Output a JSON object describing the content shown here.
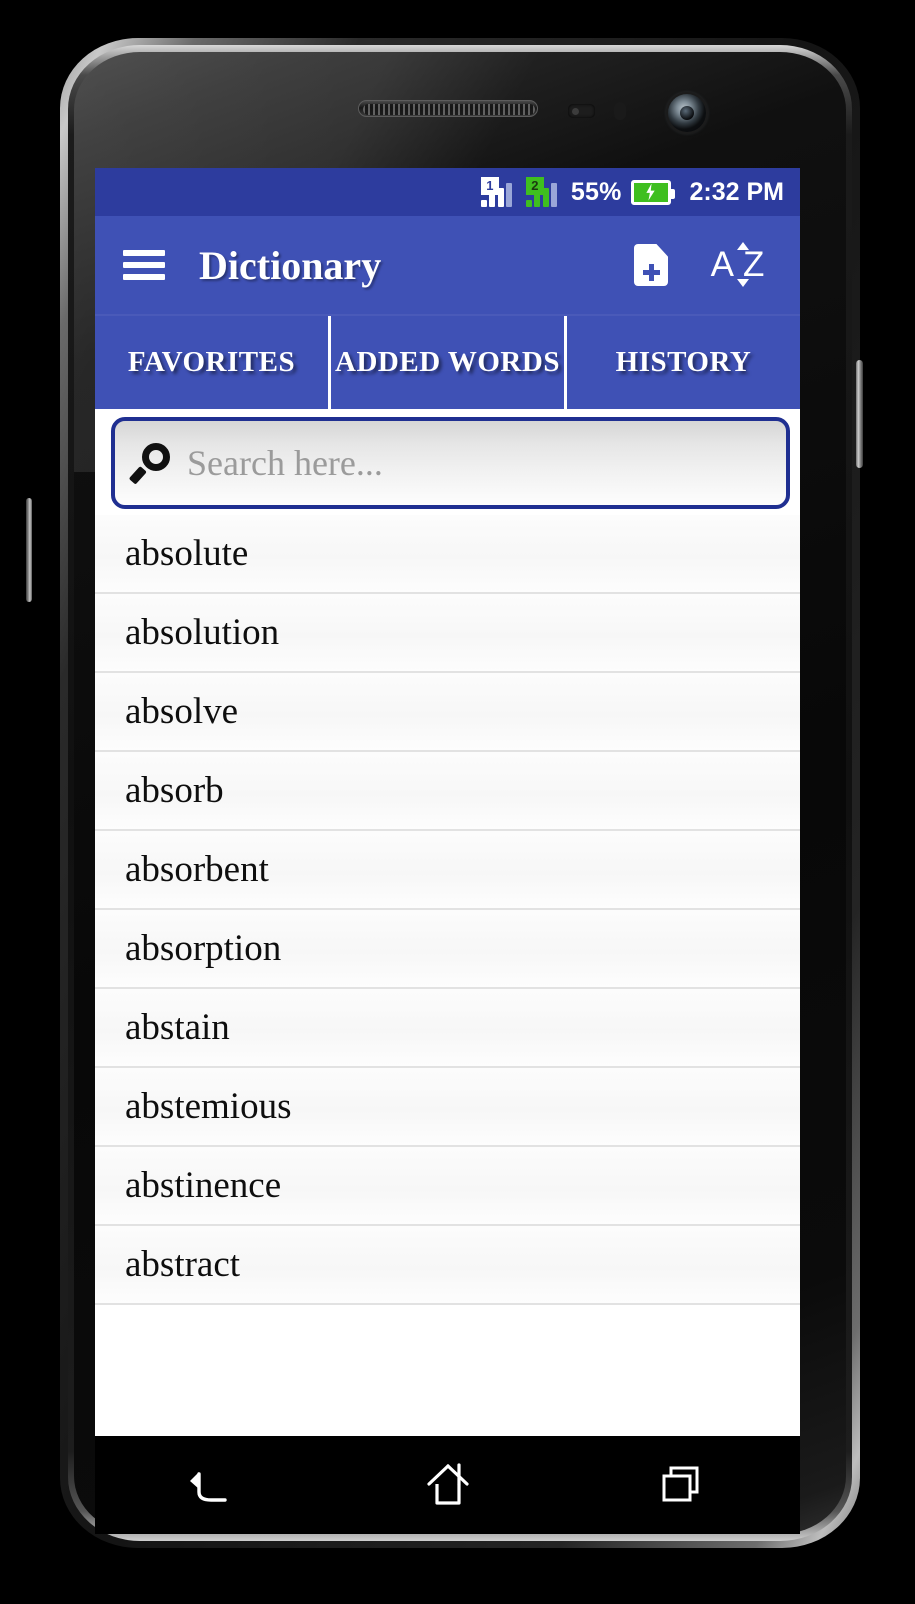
{
  "statusbar": {
    "sim1_label": "1",
    "sim2_label": "2",
    "battery_percent": "55%",
    "clock": "2:32 PM"
  },
  "appbar": {
    "title": "Dictionary",
    "menu_icon": "hamburger-menu-icon",
    "add_word_icon": "document-add-icon",
    "sort_icon": "sort-alphabetical-icon",
    "sort_label": "AZ"
  },
  "tabs": [
    {
      "label": "FAVORITES",
      "selected": true
    },
    {
      "label": "ADDED WORDS",
      "selected": false
    },
    {
      "label": "HISTORY",
      "selected": false
    }
  ],
  "search": {
    "placeholder": "Search here...",
    "value": "",
    "icon": "search-icon"
  },
  "wordlist": [
    "absolute",
    "absolution",
    "absolve",
    "absorb",
    "absorbent",
    "absorption",
    "abstain",
    "abstemious",
    "abstinence",
    "abstract"
  ],
  "navbar": {
    "back_icon": "back-arrow-icon",
    "home_icon": "home-icon",
    "recents_icon": "recent-apps-icon"
  },
  "colors": {
    "statusbar_bg": "#2d3c9e",
    "appbar_bg": "#3f51b5",
    "search_border": "#1f2f91",
    "battery_green": "#3fbf1f",
    "list_bg": "#ffffff"
  }
}
